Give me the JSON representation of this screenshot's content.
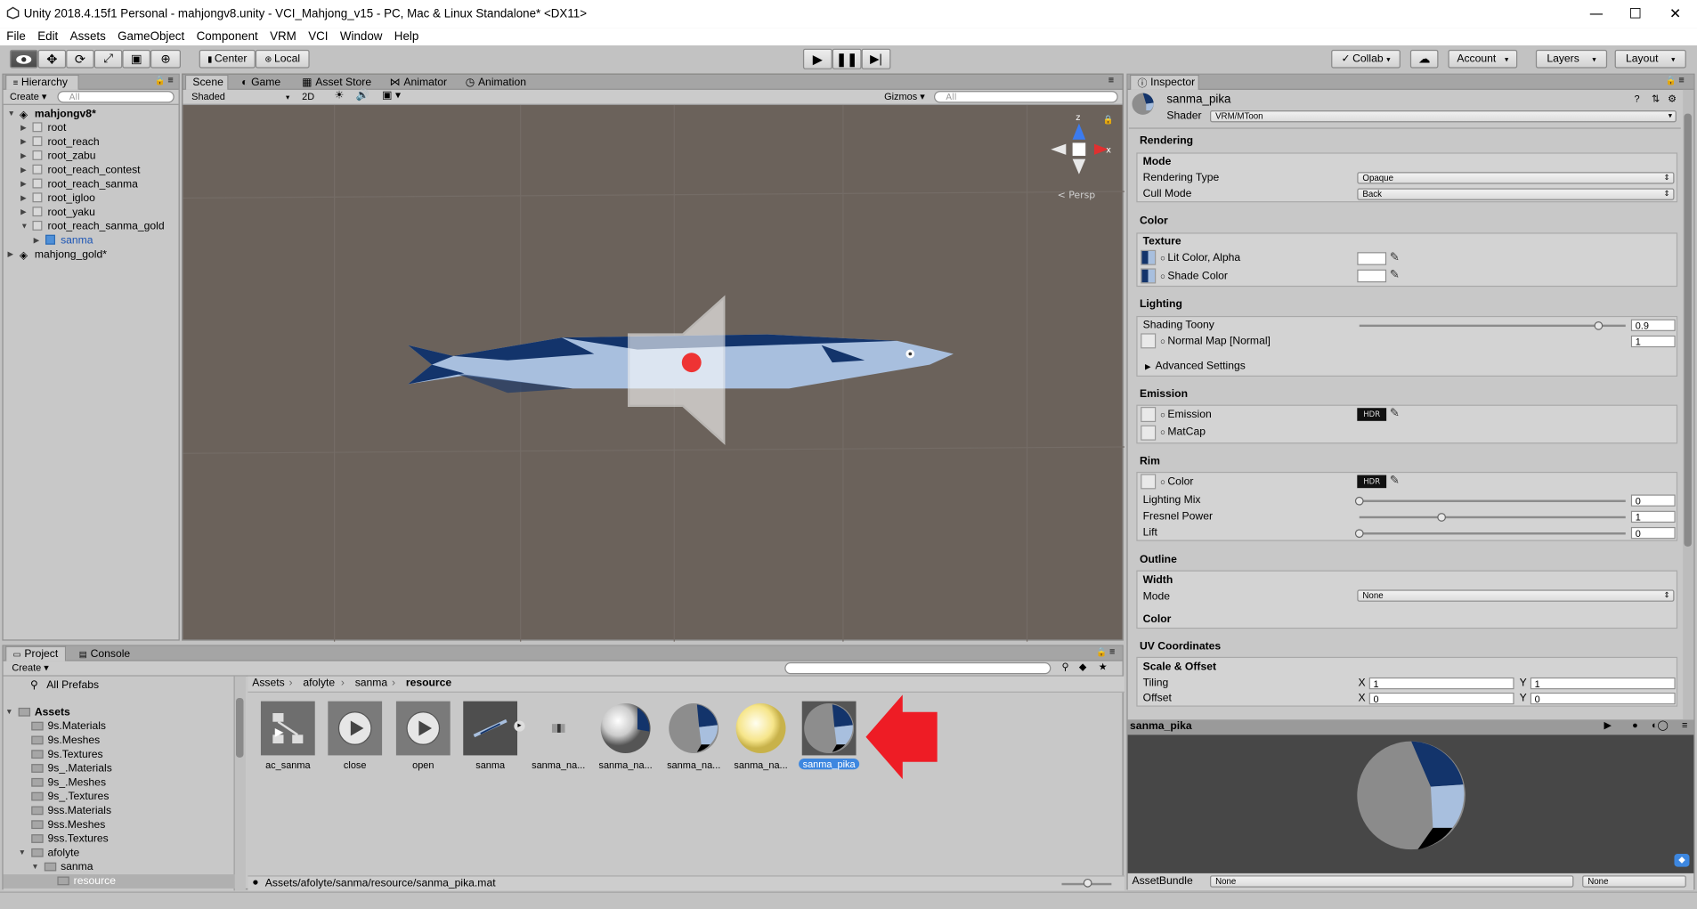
{
  "window": {
    "title": "Unity 2018.4.15f1 Personal - mahjongv8.unity - VCI_Mahjong_v15 - PC, Mac & Linux Standalone* <DX11>",
    "minimize": "—",
    "maximize": "☐",
    "close": "✕"
  },
  "menu": [
    "File",
    "Edit",
    "Assets",
    "GameObject",
    "Component",
    "VRM",
    "VCI",
    "Window",
    "Help"
  ],
  "toolbar": {
    "center": "Center",
    "local": "Local",
    "collab": "Collab",
    "account": "Account",
    "layers": "Layers",
    "layout": "Layout"
  },
  "hierarchy": {
    "tab": "Hierarchy",
    "create": "Create",
    "search": "All",
    "items": [
      {
        "label": "mahjongv8*",
        "bold": true
      },
      {
        "label": "root"
      },
      {
        "label": "root_reach"
      },
      {
        "label": "root_zabu"
      },
      {
        "label": "root_reach_contest"
      },
      {
        "label": "root_reach_sanma"
      },
      {
        "label": "root_igloo"
      },
      {
        "label": "root_yaku"
      },
      {
        "label": "root_reach_sanma_gold"
      },
      {
        "label": "sanma"
      },
      {
        "label": "mahjong_gold*"
      }
    ]
  },
  "scene": {
    "tabs": [
      "Scene",
      "Game",
      "Asset Store",
      "Animator",
      "Animation"
    ],
    "shaded": "Shaded",
    "mode2d": "2D",
    "gizmos": "Gizmos",
    "search": "All",
    "persp": "Persp",
    "axis_z": "z",
    "axis_x": "x"
  },
  "project": {
    "tabs": [
      "Project",
      "Console"
    ],
    "create": "Create",
    "favorites": "All Prefabs",
    "root": "Assets",
    "folders": [
      "9s.Materials",
      "9s.Meshes",
      "9s.Textures",
      "9s_.Materials",
      "9s_.Meshes",
      "9s_.Textures",
      "9ss.Materials",
      "9ss.Meshes",
      "9ss.Textures",
      "afolyte",
      "sanma",
      "resource"
    ],
    "breadcrumb": [
      "Assets",
      "afolyte",
      "sanma",
      "resource"
    ],
    "assets": [
      "ac_sanma",
      "close",
      "open",
      "sanma",
      "sanma_na...",
      "sanma_na...",
      "sanma_na...",
      "sanma_na...",
      "sanma_pika"
    ],
    "status": "Assets/afolyte/sanma/resource/sanma_pika.mat"
  },
  "inspector": {
    "tab": "Inspector",
    "name": "sanma_pika",
    "shader_label": "Shader",
    "shader": "VRM/MToon",
    "rendering": "Rendering",
    "mode": "Mode",
    "rendering_type_label": "Rendering Type",
    "rendering_type": "Opaque",
    "cull_mode_label": "Cull Mode",
    "cull_mode": "Back",
    "color": "Color",
    "texture": "Texture",
    "lit_color": "Lit Color, Alpha",
    "shade_color": "Shade Color",
    "lighting": "Lighting",
    "shading_toony": "Shading Toony",
    "shading_toony_val": "0.9",
    "normal_map": "Normal Map [Normal]",
    "normal_map_val": "1",
    "advanced": "Advanced Settings",
    "emission": "Emission",
    "emission_label": "Emission",
    "matcap": "MatCap",
    "hdr": "HDR",
    "rim": "Rim",
    "rim_color": "Color",
    "lighting_mix": "Lighting Mix",
    "lighting_mix_val": "0",
    "fresnel": "Fresnel Power",
    "fresnel_val": "1",
    "lift": "Lift",
    "lift_val": "0",
    "outline": "Outline",
    "width": "Width",
    "outline_mode": "Mode",
    "outline_mode_val": "None",
    "outline_color": "Color",
    "uv": "UV Coordinates",
    "scale_offset": "Scale & Offset",
    "tiling": "Tiling",
    "offset": "Offset",
    "x": "X",
    "y": "Y",
    "tiling_x": "1",
    "tiling_y": "1",
    "offset_x": "0",
    "offset_y": "0",
    "preview_name": "sanma_pika",
    "assetbundle": "AssetBundle",
    "ab_none1": "None",
    "ab_none2": "None"
  },
  "sliders": {
    "shading_toony": 0.9,
    "lighting_mix": 0,
    "fresnel": 0.31,
    "lift": 0
  },
  "colors": {
    "accent": "#3d87e0",
    "scene_bg": "#6b625b",
    "fish_dark": "#13346b",
    "fish_light": "#a8bfde",
    "red": "#ee1c25"
  }
}
